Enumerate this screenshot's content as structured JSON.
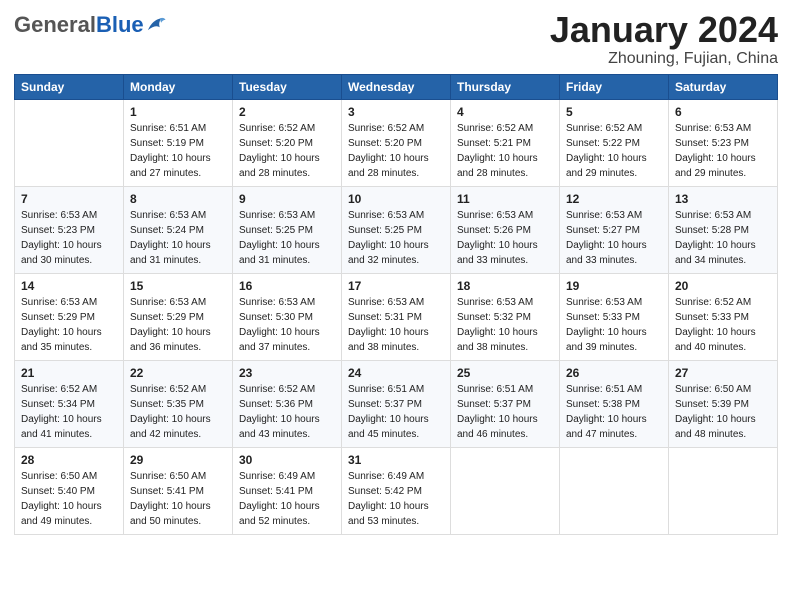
{
  "header": {
    "logo_general": "General",
    "logo_blue": "Blue",
    "month": "January 2024",
    "location": "Zhouning, Fujian, China"
  },
  "days_of_week": [
    "Sunday",
    "Monday",
    "Tuesday",
    "Wednesday",
    "Thursday",
    "Friday",
    "Saturday"
  ],
  "weeks": [
    [
      {
        "num": "",
        "detail": ""
      },
      {
        "num": "1",
        "detail": "Sunrise: 6:51 AM\nSunset: 5:19 PM\nDaylight: 10 hours\nand 27 minutes."
      },
      {
        "num": "2",
        "detail": "Sunrise: 6:52 AM\nSunset: 5:20 PM\nDaylight: 10 hours\nand 28 minutes."
      },
      {
        "num": "3",
        "detail": "Sunrise: 6:52 AM\nSunset: 5:20 PM\nDaylight: 10 hours\nand 28 minutes."
      },
      {
        "num": "4",
        "detail": "Sunrise: 6:52 AM\nSunset: 5:21 PM\nDaylight: 10 hours\nand 28 minutes."
      },
      {
        "num": "5",
        "detail": "Sunrise: 6:52 AM\nSunset: 5:22 PM\nDaylight: 10 hours\nand 29 minutes."
      },
      {
        "num": "6",
        "detail": "Sunrise: 6:53 AM\nSunset: 5:23 PM\nDaylight: 10 hours\nand 29 minutes."
      }
    ],
    [
      {
        "num": "7",
        "detail": "Sunrise: 6:53 AM\nSunset: 5:23 PM\nDaylight: 10 hours\nand 30 minutes."
      },
      {
        "num": "8",
        "detail": "Sunrise: 6:53 AM\nSunset: 5:24 PM\nDaylight: 10 hours\nand 31 minutes."
      },
      {
        "num": "9",
        "detail": "Sunrise: 6:53 AM\nSunset: 5:25 PM\nDaylight: 10 hours\nand 31 minutes."
      },
      {
        "num": "10",
        "detail": "Sunrise: 6:53 AM\nSunset: 5:25 PM\nDaylight: 10 hours\nand 32 minutes."
      },
      {
        "num": "11",
        "detail": "Sunrise: 6:53 AM\nSunset: 5:26 PM\nDaylight: 10 hours\nand 33 minutes."
      },
      {
        "num": "12",
        "detail": "Sunrise: 6:53 AM\nSunset: 5:27 PM\nDaylight: 10 hours\nand 33 minutes."
      },
      {
        "num": "13",
        "detail": "Sunrise: 6:53 AM\nSunset: 5:28 PM\nDaylight: 10 hours\nand 34 minutes."
      }
    ],
    [
      {
        "num": "14",
        "detail": "Sunrise: 6:53 AM\nSunset: 5:29 PM\nDaylight: 10 hours\nand 35 minutes."
      },
      {
        "num": "15",
        "detail": "Sunrise: 6:53 AM\nSunset: 5:29 PM\nDaylight: 10 hours\nand 36 minutes."
      },
      {
        "num": "16",
        "detail": "Sunrise: 6:53 AM\nSunset: 5:30 PM\nDaylight: 10 hours\nand 37 minutes."
      },
      {
        "num": "17",
        "detail": "Sunrise: 6:53 AM\nSunset: 5:31 PM\nDaylight: 10 hours\nand 38 minutes."
      },
      {
        "num": "18",
        "detail": "Sunrise: 6:53 AM\nSunset: 5:32 PM\nDaylight: 10 hours\nand 38 minutes."
      },
      {
        "num": "19",
        "detail": "Sunrise: 6:53 AM\nSunset: 5:33 PM\nDaylight: 10 hours\nand 39 minutes."
      },
      {
        "num": "20",
        "detail": "Sunrise: 6:52 AM\nSunset: 5:33 PM\nDaylight: 10 hours\nand 40 minutes."
      }
    ],
    [
      {
        "num": "21",
        "detail": "Sunrise: 6:52 AM\nSunset: 5:34 PM\nDaylight: 10 hours\nand 41 minutes."
      },
      {
        "num": "22",
        "detail": "Sunrise: 6:52 AM\nSunset: 5:35 PM\nDaylight: 10 hours\nand 42 minutes."
      },
      {
        "num": "23",
        "detail": "Sunrise: 6:52 AM\nSunset: 5:36 PM\nDaylight: 10 hours\nand 43 minutes."
      },
      {
        "num": "24",
        "detail": "Sunrise: 6:51 AM\nSunset: 5:37 PM\nDaylight: 10 hours\nand 45 minutes."
      },
      {
        "num": "25",
        "detail": "Sunrise: 6:51 AM\nSunset: 5:37 PM\nDaylight: 10 hours\nand 46 minutes."
      },
      {
        "num": "26",
        "detail": "Sunrise: 6:51 AM\nSunset: 5:38 PM\nDaylight: 10 hours\nand 47 minutes."
      },
      {
        "num": "27",
        "detail": "Sunrise: 6:50 AM\nSunset: 5:39 PM\nDaylight: 10 hours\nand 48 minutes."
      }
    ],
    [
      {
        "num": "28",
        "detail": "Sunrise: 6:50 AM\nSunset: 5:40 PM\nDaylight: 10 hours\nand 49 minutes."
      },
      {
        "num": "29",
        "detail": "Sunrise: 6:50 AM\nSunset: 5:41 PM\nDaylight: 10 hours\nand 50 minutes."
      },
      {
        "num": "30",
        "detail": "Sunrise: 6:49 AM\nSunset: 5:41 PM\nDaylight: 10 hours\nand 52 minutes."
      },
      {
        "num": "31",
        "detail": "Sunrise: 6:49 AM\nSunset: 5:42 PM\nDaylight: 10 hours\nand 53 minutes."
      },
      {
        "num": "",
        "detail": ""
      },
      {
        "num": "",
        "detail": ""
      },
      {
        "num": "",
        "detail": ""
      }
    ]
  ]
}
